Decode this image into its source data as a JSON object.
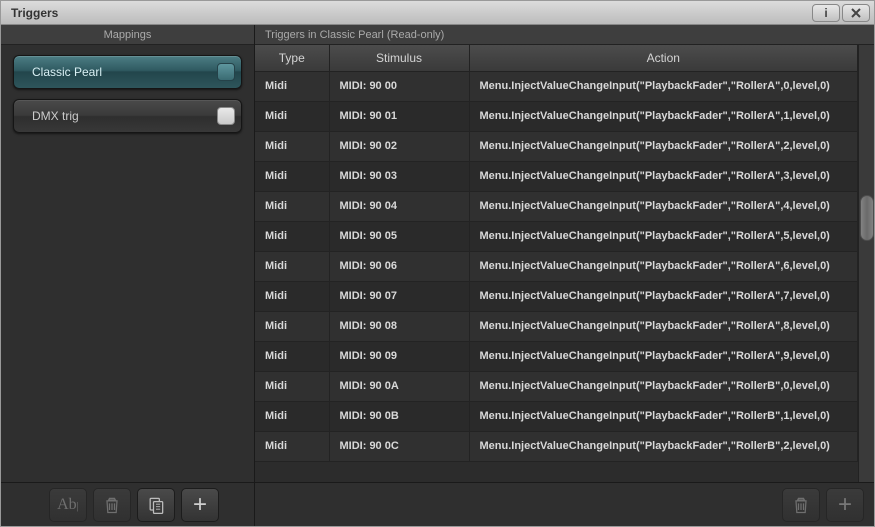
{
  "title": "Triggers",
  "left": {
    "header": "Mappings",
    "items": [
      {
        "label": "Classic Pearl",
        "selected": true
      },
      {
        "label": "DMX trig",
        "selected": false
      }
    ],
    "toolbar": {
      "rename": "Ab|",
      "delete": "delete",
      "copy": "copy",
      "add": "+"
    }
  },
  "right": {
    "header": "Triggers in Classic Pearl (Read-only)",
    "columns": {
      "type": "Type",
      "stimulus": "Stimulus",
      "action": "Action"
    },
    "rows": [
      {
        "type": "Midi",
        "stimulus": "MIDI: 90 00",
        "action": "Menu.InjectValueChangeInput(\"PlaybackFader\",\"RollerA\",0,level,0)"
      },
      {
        "type": "Midi",
        "stimulus": "MIDI: 90 01",
        "action": "Menu.InjectValueChangeInput(\"PlaybackFader\",\"RollerA\",1,level,0)"
      },
      {
        "type": "Midi",
        "stimulus": "MIDI: 90 02",
        "action": "Menu.InjectValueChangeInput(\"PlaybackFader\",\"RollerA\",2,level,0)"
      },
      {
        "type": "Midi",
        "stimulus": "MIDI: 90 03",
        "action": "Menu.InjectValueChangeInput(\"PlaybackFader\",\"RollerA\",3,level,0)"
      },
      {
        "type": "Midi",
        "stimulus": "MIDI: 90 04",
        "action": "Menu.InjectValueChangeInput(\"PlaybackFader\",\"RollerA\",4,level,0)"
      },
      {
        "type": "Midi",
        "stimulus": "MIDI: 90 05",
        "action": "Menu.InjectValueChangeInput(\"PlaybackFader\",\"RollerA\",5,level,0)"
      },
      {
        "type": "Midi",
        "stimulus": "MIDI: 90 06",
        "action": "Menu.InjectValueChangeInput(\"PlaybackFader\",\"RollerA\",6,level,0)"
      },
      {
        "type": "Midi",
        "stimulus": "MIDI: 90 07",
        "action": "Menu.InjectValueChangeInput(\"PlaybackFader\",\"RollerA\",7,level,0)"
      },
      {
        "type": "Midi",
        "stimulus": "MIDI: 90 08",
        "action": "Menu.InjectValueChangeInput(\"PlaybackFader\",\"RollerA\",8,level,0)"
      },
      {
        "type": "Midi",
        "stimulus": "MIDI: 90 09",
        "action": "Menu.InjectValueChangeInput(\"PlaybackFader\",\"RollerA\",9,level,0)"
      },
      {
        "type": "Midi",
        "stimulus": "MIDI: 90 0A",
        "action": "Menu.InjectValueChangeInput(\"PlaybackFader\",\"RollerB\",0,level,0)"
      },
      {
        "type": "Midi",
        "stimulus": "MIDI: 90 0B",
        "action": "Menu.InjectValueChangeInput(\"PlaybackFader\",\"RollerB\",1,level,0)"
      },
      {
        "type": "Midi",
        "stimulus": "MIDI: 90 0C",
        "action": "Menu.InjectValueChangeInput(\"PlaybackFader\",\"RollerB\",2,level,0)"
      }
    ],
    "toolbar": {
      "delete": "delete",
      "add": "+"
    }
  }
}
